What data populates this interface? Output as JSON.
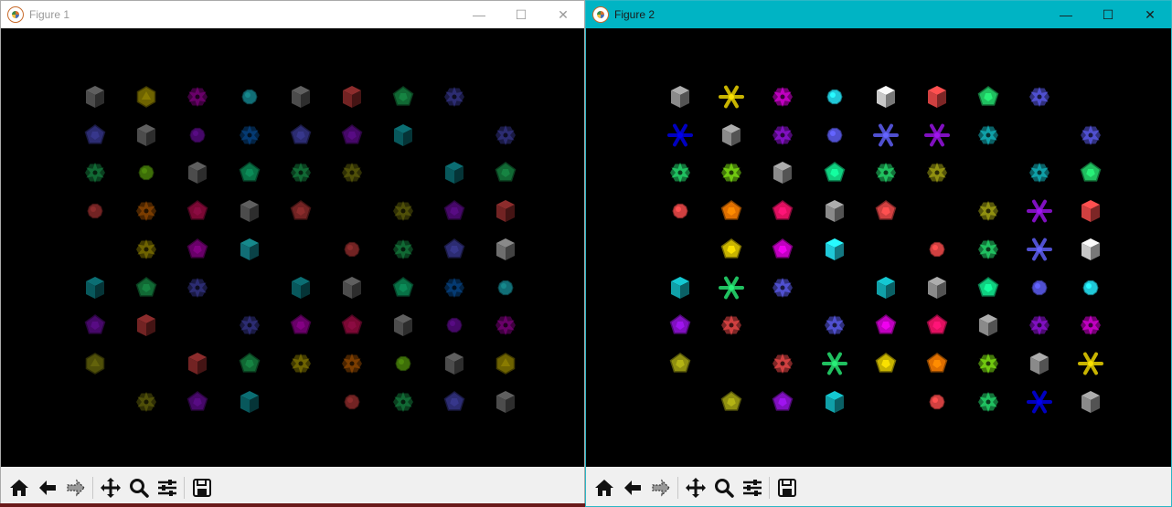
{
  "windows": [
    {
      "title": "Figure 1",
      "dim": true,
      "grid": [
        [
          "cube-gray",
          "ico-yellow",
          "star-magenta",
          "sphere-cyan",
          "cube-gray",
          "cube-red",
          "dodec-green",
          "star-blue",
          null
        ],
        [
          "dodec-blue",
          "cube-gray",
          "sphere-purple",
          "star-blue2",
          "dodec-blue",
          "dodec-purple",
          "cube-teal",
          null,
          "star-blue"
        ],
        [
          "star-green",
          "sphere-lime",
          "cube-gray",
          "dodec-green2",
          "star-green",
          "star-olive",
          null,
          "cube-teal",
          "dodec-green"
        ],
        [
          "sphere-red",
          "star-orange",
          "dodec-pink",
          "cube-gray",
          "dodec-red",
          null,
          "star-olive",
          "dodec-purple",
          "cube-red"
        ],
        [
          null,
          "star-yellow",
          "dodec-magenta",
          "cube-cyan",
          null,
          "sphere-red",
          "star-green",
          "dodec-blue",
          "cube-lightgray"
        ],
        [
          "cube-teal",
          "dodec-green",
          "star-blue",
          null,
          "cube-teal",
          "cube-gray",
          "dodec-green2",
          "star-blue2",
          "sphere-cyan"
        ],
        [
          "dodec-purple",
          "cube-red",
          null,
          "star-blue",
          "dodec-magenta",
          "dodec-pink",
          "cube-gray",
          "sphere-purple",
          "star-magenta"
        ],
        [
          "ico-olive",
          null,
          "cube-red",
          "dodec-green",
          "star-yellow",
          "star-orange",
          "sphere-lime",
          "cube-gray",
          "ico-yellow"
        ],
        [
          null,
          "star-olive",
          "dodec-purple",
          "cube-teal",
          null,
          "sphere-red",
          "star-green",
          "dodec-blue",
          "cube-gray"
        ]
      ]
    },
    {
      "title": "Figure 2",
      "dim": false,
      "grid": [
        [
          "cube-gray",
          "asterisk-yellow",
          "star-magenta",
          "sphere-cyan",
          "cube-lightgray",
          "cube-red",
          "dodec-green",
          "star-blue",
          null
        ],
        [
          "asterisk-navy",
          "cube-gray",
          "star-purple",
          "sphere-blue",
          "asterisk-blue",
          "asterisk-purple",
          "star-teal",
          null,
          "star-blue"
        ],
        [
          "star-green",
          "star-lime",
          "cube-gray",
          "dodec-green2",
          "star-green",
          "star-olive",
          null,
          "star-teal",
          "dodec-green"
        ],
        [
          "sphere-red",
          "dodec-orange",
          "dodec-pink",
          "cube-gray",
          "dodec-red",
          null,
          "star-olive",
          "asterisk-purple",
          "cube-red"
        ],
        [
          null,
          "dodec-yellow",
          "dodec-magenta",
          "cube-cyan",
          null,
          "sphere-red",
          "star-green",
          "asterisk-blue",
          "cube-lightgray"
        ],
        [
          "cube-teal",
          "asterisk-green",
          "star-blue",
          null,
          "cube-teal",
          "cube-gray",
          "dodec-green2",
          "sphere-blue",
          "sphere-cyan"
        ],
        [
          "dodec-purple",
          "star-red",
          null,
          "star-blue",
          "dodec-magenta",
          "dodec-pink",
          "cube-gray",
          "star-purple",
          "star-magenta"
        ],
        [
          "dodec-olive",
          null,
          "star-red",
          "asterisk-green",
          "dodec-yellow",
          "dodec-orange",
          "star-lime",
          "cube-gray",
          "asterisk-yellow"
        ],
        [
          null,
          "dodec-olive",
          "dodec-purple",
          "cube-teal",
          null,
          "sphere-red",
          "star-green",
          "asterisk-navy",
          "cube-gray"
        ]
      ]
    }
  ],
  "window_controls": [
    "minimize-icon",
    "maximize-icon",
    "close-icon"
  ],
  "toolbar_buttons": [
    "home-icon",
    "back-icon",
    "forward-icon",
    "separator",
    "pan-icon",
    "zoom-icon",
    "configure-subplots-icon",
    "separator",
    "save-icon"
  ],
  "colors": {
    "gray": "#8a8a8a",
    "lightgray": "#c8c8c8",
    "yellow": "#c8b400",
    "magenta": "#c000c0",
    "cyan": "#20c8d8",
    "red": "#d04040",
    "green": "#20c060",
    "green2": "#10d080",
    "blue": "#5050d0",
    "blue2": "#0a6ad0",
    "purple": "#8010c0",
    "teal": "#10a0a8",
    "lime": "#70c810",
    "olive": "#909010",
    "orange": "#e07000",
    "pink": "#e01060",
    "navy": "#0000c0",
    "window_accent": "#00b4c4"
  }
}
